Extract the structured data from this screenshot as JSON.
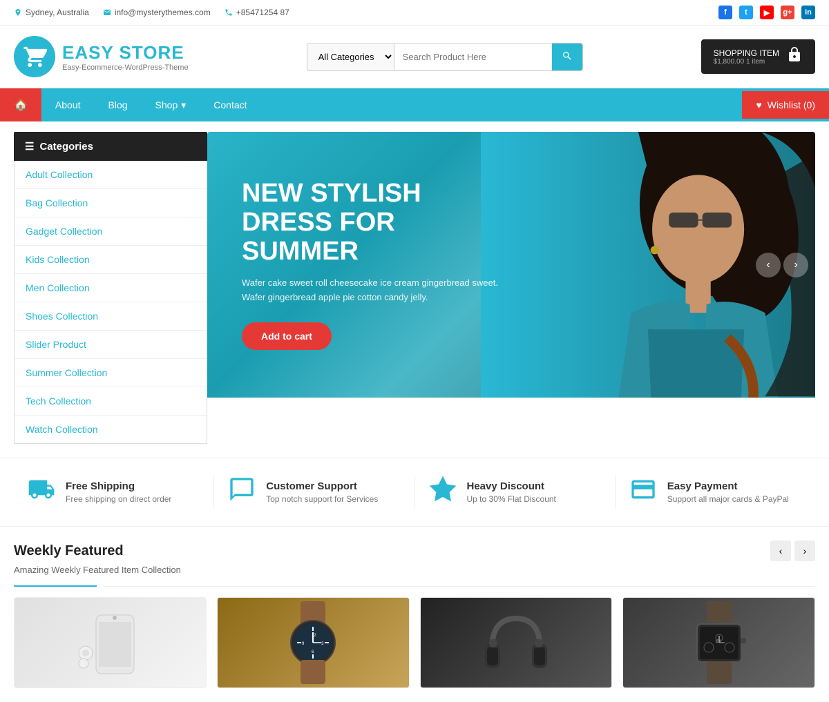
{
  "topbar": {
    "location": "Sydney, Australia",
    "email": "info@mysterythemes.com",
    "phone": "+85471254 87",
    "socials": [
      "f",
      "t",
      "yt",
      "g+",
      "in"
    ]
  },
  "header": {
    "logo_brand": "EASY STORE",
    "logo_sub": "Easy-Ecommerce-WordPress-Theme",
    "search_placeholder": "Search Product Here",
    "search_category": "All Categories",
    "cart_label": "SHOPPING ITEM",
    "cart_amount": "$1,800.00",
    "cart_items": "1 item"
  },
  "nav": {
    "home_icon": "🏠",
    "items": [
      "About",
      "Blog",
      "Shop",
      "Contact"
    ],
    "shop_has_dropdown": true,
    "wishlist_label": "Wishlist (0)"
  },
  "sidebar": {
    "title": "Categories",
    "items": [
      "Adult Collection",
      "Bag Collection",
      "Gadget Collection",
      "Kids Collection",
      "Men Collection",
      "Shoes Collection",
      "Slider Product",
      "Summer Collection",
      "Tech Collection",
      "Watch Collection"
    ]
  },
  "hero": {
    "title": "NEW STYLISH DRESS FOR SUMMER",
    "description": "Wafer cake sweet roll cheesecake ice cream gingerbread sweet. Wafer gingerbread apple pie cotton candy jelly.",
    "btn_label": "Add to cart"
  },
  "features": [
    {
      "icon": "truck",
      "title": "Free Shipping",
      "desc": "Free shipping on direct order"
    },
    {
      "icon": "chat",
      "title": "Customer Support",
      "desc": "Top notch support for Services"
    },
    {
      "icon": "star",
      "title": "Heavy Discount",
      "desc": "Up to 30% Flat Discount"
    },
    {
      "icon": "card",
      "title": "Easy Payment",
      "desc": "Support all major cards & PayPal"
    }
  ],
  "weekly": {
    "title": "Weekly Featured",
    "subtitle": "Amazing Weekly Featured Item Collection"
  },
  "products": [
    {
      "id": 1,
      "type": "phone-earbuds"
    },
    {
      "id": 2,
      "type": "watch-leather"
    },
    {
      "id": 3,
      "type": "headphones"
    },
    {
      "id": 4,
      "type": "watch-dark"
    }
  ]
}
